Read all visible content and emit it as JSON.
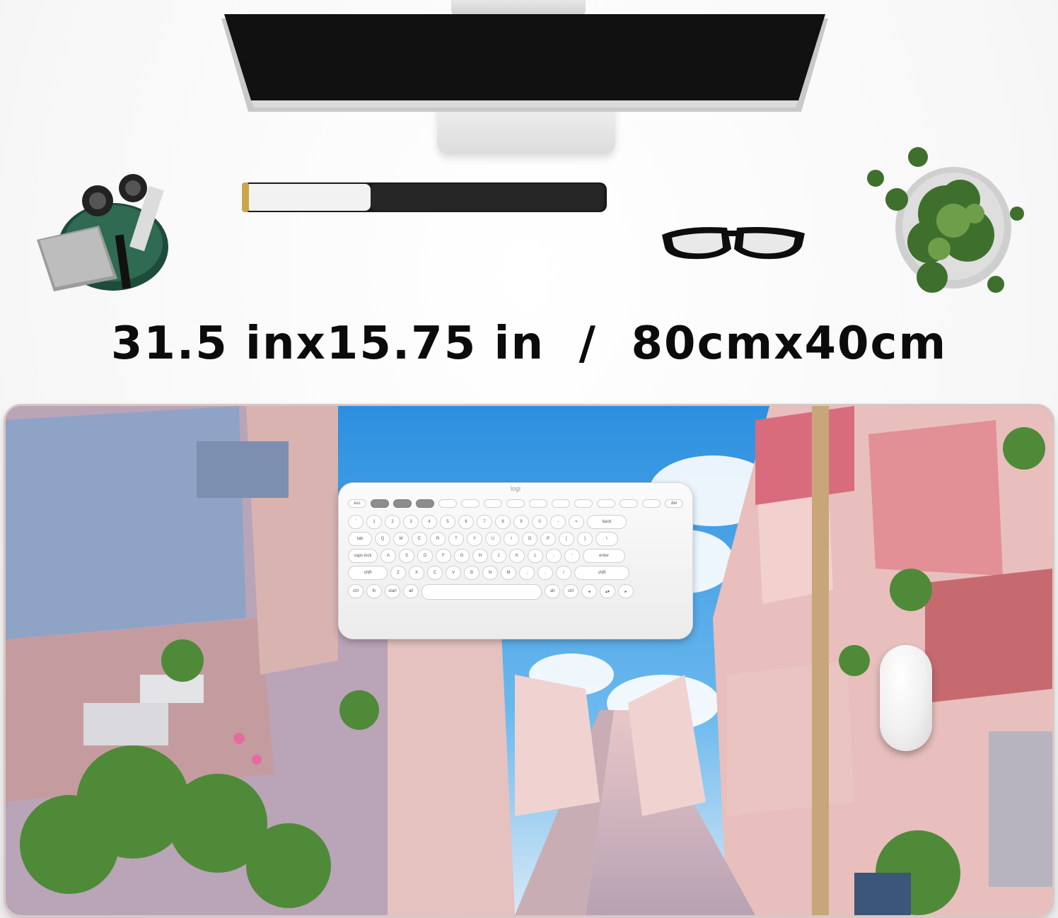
{
  "product": {
    "dimension_text": "31.5 inx15.75 in  /  80cmx40cm"
  },
  "keyboard": {
    "brand_logo": "logi",
    "rows": [
      [
        "esc",
        "",
        "",
        "",
        "",
        "",
        "",
        "",
        "",
        "",
        "",
        "",
        "",
        "",
        "del"
      ],
      [
        "`",
        "1",
        "2",
        "3",
        "4",
        "5",
        "6",
        "7",
        "8",
        "9",
        "0",
        "-",
        "=",
        "back"
      ],
      [
        "tab",
        "Q",
        "W",
        "E",
        "R",
        "T",
        "Y",
        "U",
        "I",
        "O",
        "P",
        "[",
        "]",
        "\\"
      ],
      [
        "caps lock",
        "A",
        "S",
        "D",
        "F",
        "G",
        "H",
        "J",
        "K",
        "L",
        ";",
        "'",
        "enter"
      ],
      [
        "shift",
        "Z",
        "X",
        "C",
        "V",
        "B",
        "N",
        "M",
        ",",
        ".",
        "/",
        "shift"
      ],
      [
        "ctrl",
        "fn",
        "start",
        "alt",
        "",
        "alt",
        "ctrl",
        "◂",
        "▴▾",
        "▸"
      ]
    ]
  },
  "colors": {
    "sky": "#3a9be0",
    "building_pink": "#e8b9b8",
    "plant_green": "#5b8f3c",
    "text": "#0b0b0b"
  },
  "icons": {
    "monitor": "monitor-icon",
    "pen_holder": "pen-holder-icon",
    "lamp": "lamp-icon",
    "glasses": "glasses-icon",
    "plant": "plant-icon",
    "mouse": "mouse-icon"
  }
}
